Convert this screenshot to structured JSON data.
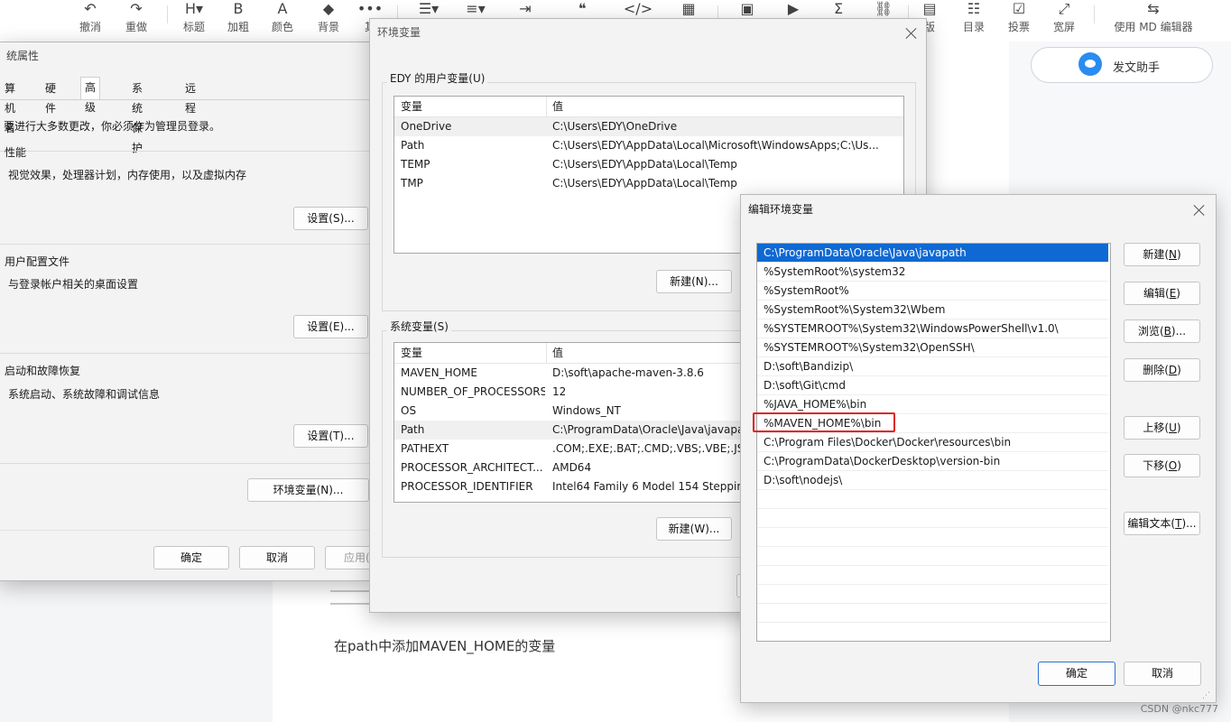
{
  "editor": {
    "toolbar": [
      {
        "icon": "↶",
        "label": "撤消",
        "name": "undo"
      },
      {
        "icon": "↷",
        "label": "重做",
        "name": "redo"
      },
      {
        "icon": "H▾",
        "label": "标题",
        "name": "heading"
      },
      {
        "icon": "B",
        "label": "加粗",
        "name": "bold"
      },
      {
        "icon": "A",
        "label": "颜色",
        "name": "color"
      },
      {
        "icon": "◆",
        "label": "背景",
        "name": "background"
      },
      {
        "icon": "•••",
        "label": "其",
        "name": "more"
      },
      {
        "icon": "☰▾",
        "label": "",
        "name": "list"
      },
      {
        "icon": "≡▾",
        "label": "",
        "name": "align"
      },
      {
        "icon": "⇥",
        "label": "",
        "name": "indent"
      },
      {
        "icon": "❝",
        "label": "",
        "name": "quote"
      },
      {
        "icon": "</>",
        "label": "",
        "name": "code"
      },
      {
        "icon": "▦",
        "label": "",
        "name": "table"
      },
      {
        "icon": "▣",
        "label": "",
        "name": "image"
      },
      {
        "icon": "▶",
        "label": "",
        "name": "video"
      },
      {
        "icon": "Σ",
        "label": "",
        "name": "formula"
      },
      {
        "icon": "⛓",
        "label": "",
        "name": "link"
      },
      {
        "icon": "▤",
        "label": "版",
        "name": "template"
      },
      {
        "icon": "☷",
        "label": "目录",
        "name": "toc"
      },
      {
        "icon": "☑",
        "label": "投票",
        "name": "vote"
      },
      {
        "icon": "⤢",
        "label": "宽屏",
        "name": "widescreen"
      },
      {
        "icon": "⇆",
        "label": "使用 MD 编辑器",
        "name": "md-editor"
      }
    ],
    "assistant_label": "发文助手",
    "caption": "在path中添加MAVEN_HOME的变量",
    "watermark": "CSDN @nkc777"
  },
  "sys_props": {
    "title": "统属性",
    "tabs": [
      "算机名",
      "硬件",
      "高级",
      "系统保护",
      "远程"
    ],
    "active_tab": "高级",
    "admin_note": "要进行大多数更改，你必须作为管理员登录。",
    "performance": {
      "title": "性能",
      "desc": "视觉效果，处理器计划，内存使用，以及虚拟内存",
      "button": "设置(S)..."
    },
    "profile": {
      "title": "用户配置文件",
      "desc": "与登录帐户相关的桌面设置",
      "button": "设置(E)..."
    },
    "startup": {
      "title": "启动和故障恢复",
      "desc": "系统启动、系统故障和调试信息",
      "button": "设置(T)..."
    },
    "env_button": "环境变量(N)...",
    "ok": "确定",
    "cancel": "取消",
    "apply": "应用("
  },
  "env_vars": {
    "title": "环境变量",
    "user_group": "EDY 的用户变量(U)",
    "col_var": "变量",
    "col_val": "值",
    "user_rows": [
      {
        "name": "OneDrive",
        "value": "C:\\Users\\EDY\\OneDrive"
      },
      {
        "name": "Path",
        "value": "C:\\Users\\EDY\\AppData\\Local\\Microsoft\\WindowsApps;C:\\Us..."
      },
      {
        "name": "TEMP",
        "value": "C:\\Users\\EDY\\AppData\\Local\\Temp"
      },
      {
        "name": "TMP",
        "value": "C:\\Users\\EDY\\AppData\\Local\\Temp"
      }
    ],
    "user_new": "新建(N)...",
    "sys_group": "系统变量(S)",
    "sys_rows": [
      {
        "name": "MAVEN_HOME",
        "value": "D:\\soft\\apache-maven-3.8.6"
      },
      {
        "name": "NUMBER_OF_PROCESSORS",
        "value": "12"
      },
      {
        "name": "OS",
        "value": "Windows_NT"
      },
      {
        "name": "Path",
        "value": "C:\\ProgramData\\Oracle\\Java\\javapa"
      },
      {
        "name": "PATHEXT",
        "value": ".COM;.EXE;.BAT;.CMD;.VBS;.VBE;.JS;."
      },
      {
        "name": "PROCESSOR_ARCHITECT...",
        "value": "AMD64"
      },
      {
        "name": "PROCESSOR_IDENTIFIER",
        "value": "Intel64 Family 6 Model 154 Stepping"
      }
    ],
    "sys_new": "新建(W)..."
  },
  "edit_env": {
    "title": "编辑环境变量",
    "entries": [
      "C:\\ProgramData\\Oracle\\Java\\javapath",
      "%SystemRoot%\\system32",
      "%SystemRoot%",
      "%SystemRoot%\\System32\\Wbem",
      "%SYSTEMROOT%\\System32\\WindowsPowerShell\\v1.0\\",
      "%SYSTEMROOT%\\System32\\OpenSSH\\",
      "D:\\soft\\Bandizip\\",
      "D:\\soft\\Git\\cmd",
      "%JAVA_HOME%\\bin",
      "%MAVEN_HOME%\\bin",
      "C:\\Program Files\\Docker\\Docker\\resources\\bin",
      "C:\\ProgramData\\DockerDesktop\\version-bin",
      "D:\\soft\\nodejs\\"
    ],
    "buttons": {
      "new": {
        "text": "新建(",
        "key": "N",
        "end": ")"
      },
      "edit": {
        "text": "编辑(",
        "key": "E",
        "end": ")"
      },
      "browse": {
        "text": "浏览(",
        "key": "B",
        "end": ")..."
      },
      "delete": {
        "text": "删除(",
        "key": "D",
        "end": ")"
      },
      "up": {
        "text": "上移(",
        "key": "U",
        "end": ")"
      },
      "down": {
        "text": "下移(",
        "key": "O",
        "end": ")"
      },
      "edit_text": {
        "text": "编辑文本(",
        "key": "T",
        "end": ")..."
      }
    },
    "ok": "确定",
    "cancel": "取消"
  }
}
